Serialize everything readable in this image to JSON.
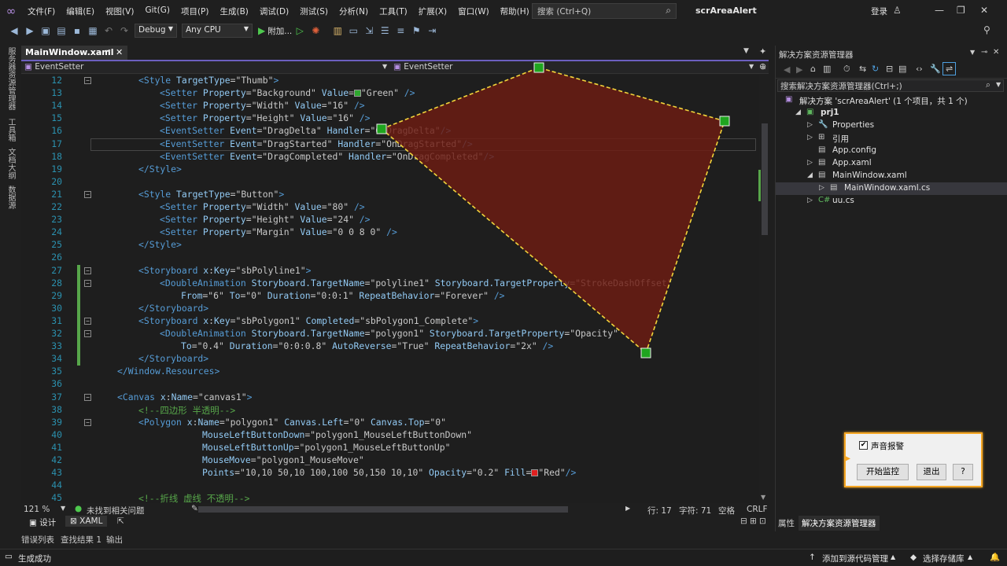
{
  "menu": {
    "items": [
      "文件(F)",
      "编辑(E)",
      "视图(V)",
      "Git(G)",
      "项目(P)",
      "生成(B)",
      "调试(D)",
      "测试(S)",
      "分析(N)",
      "工具(T)",
      "扩展(X)",
      "窗口(W)",
      "帮助(H)"
    ],
    "search_placeholder": "搜索 (Ctrl+Q)",
    "solution_name": "scrAreaAlert",
    "login": "登录"
  },
  "toolbar": {
    "config": "Debug",
    "platform": "Any CPU",
    "attach": "附加..."
  },
  "left_strip": [
    "服务器资源管理器",
    "工具箱",
    "文档大纲",
    "数据源"
  ],
  "tab": {
    "label": "MainWindow.xaml"
  },
  "nav": {
    "left": "EventSetter",
    "right": "EventSetter"
  },
  "code": [
    {
      "n": "12",
      "s": [
        [
          "t",
          "<Style "
        ],
        [
          "an",
          "TargetType"
        ],
        [
          "q",
          "=\""
        ],
        [
          "av",
          "Thumb"
        ],
        [
          "q",
          "\""
        ],
        [
          "t",
          ">"
        ]
      ]
    },
    {
      "n": "13",
      "s": [
        [
          "t",
          "<Setter "
        ],
        [
          "an",
          "Property"
        ],
        [
          "q",
          "=\""
        ],
        [
          "av",
          "Background"
        ],
        [
          "q",
          "\" "
        ],
        [
          "an",
          "Value"
        ],
        [
          "q",
          "="
        ],
        [
          "sw",
          "#2fa82f"
        ],
        [
          "q",
          "\""
        ],
        [
          "av",
          "Green"
        ],
        [
          "q",
          "\" "
        ],
        [
          "t",
          "/>"
        ]
      ]
    },
    {
      "n": "14",
      "s": [
        [
          "t",
          "<Setter "
        ],
        [
          "an",
          "Property"
        ],
        [
          "q",
          "=\""
        ],
        [
          "av",
          "Width"
        ],
        [
          "q",
          "\" "
        ],
        [
          "an",
          "Value"
        ],
        [
          "q",
          "=\""
        ],
        [
          "av",
          "16"
        ],
        [
          "q",
          "\" "
        ],
        [
          "t",
          "/>"
        ]
      ]
    },
    {
      "n": "15",
      "s": [
        [
          "t",
          "<Setter "
        ],
        [
          "an",
          "Property"
        ],
        [
          "q",
          "=\""
        ],
        [
          "av",
          "Height"
        ],
        [
          "q",
          "\" "
        ],
        [
          "an",
          "Value"
        ],
        [
          "q",
          "=\""
        ],
        [
          "av",
          "16"
        ],
        [
          "q",
          "\" "
        ],
        [
          "t",
          "/>"
        ]
      ]
    },
    {
      "n": "16",
      "s": [
        [
          "t",
          "<EventSetter "
        ],
        [
          "an",
          "Event"
        ],
        [
          "q",
          "=\""
        ],
        [
          "av",
          "DragDelta"
        ],
        [
          "q",
          "\" "
        ],
        [
          "an",
          "Handler"
        ],
        [
          "q",
          "=\""
        ],
        [
          "av",
          "OnDragDelta"
        ],
        [
          "q",
          "\""
        ],
        [
          "t",
          "/>"
        ]
      ]
    },
    {
      "n": "17",
      "s": [
        [
          "t",
          "<EventSetter "
        ],
        [
          "an",
          "Event"
        ],
        [
          "q",
          "=\""
        ],
        [
          "av",
          "DragStarted"
        ],
        [
          "q",
          "\" "
        ],
        [
          "an",
          "Handler"
        ],
        [
          "q",
          "=\""
        ],
        [
          "av",
          "OnDragStarted"
        ],
        [
          "q",
          "\""
        ],
        [
          "t",
          "/>"
        ]
      ]
    },
    {
      "n": "18",
      "s": [
        [
          "t",
          "<EventSetter "
        ],
        [
          "an",
          "Event"
        ],
        [
          "q",
          "=\""
        ],
        [
          "av",
          "DragCompleted"
        ],
        [
          "q",
          "\" "
        ],
        [
          "an",
          "Handler"
        ],
        [
          "q",
          "=\""
        ],
        [
          "av",
          "OnDragCompleted"
        ],
        [
          "q",
          "\""
        ],
        [
          "t",
          "/>"
        ]
      ]
    },
    {
      "n": "19",
      "s": [
        [
          "t",
          "</Style>"
        ]
      ]
    },
    {
      "n": "20",
      "s": []
    },
    {
      "n": "21",
      "s": [
        [
          "t",
          "<Style "
        ],
        [
          "an",
          "TargetType"
        ],
        [
          "q",
          "=\""
        ],
        [
          "av",
          "Button"
        ],
        [
          "q",
          "\""
        ],
        [
          "t",
          ">"
        ]
      ]
    },
    {
      "n": "22",
      "s": [
        [
          "t",
          "<Setter "
        ],
        [
          "an",
          "Property"
        ],
        [
          "q",
          "=\""
        ],
        [
          "av",
          "Width"
        ],
        [
          "q",
          "\" "
        ],
        [
          "an",
          "Value"
        ],
        [
          "q",
          "=\""
        ],
        [
          "av",
          "80"
        ],
        [
          "q",
          "\" "
        ],
        [
          "t",
          "/>"
        ]
      ]
    },
    {
      "n": "23",
      "s": [
        [
          "t",
          "<Setter "
        ],
        [
          "an",
          "Property"
        ],
        [
          "q",
          "=\""
        ],
        [
          "av",
          "Height"
        ],
        [
          "q",
          "\" "
        ],
        [
          "an",
          "Value"
        ],
        [
          "q",
          "=\""
        ],
        [
          "av",
          "24"
        ],
        [
          "q",
          "\" "
        ],
        [
          "t",
          "/>"
        ]
      ]
    },
    {
      "n": "24",
      "s": [
        [
          "t",
          "<Setter "
        ],
        [
          "an",
          "Property"
        ],
        [
          "q",
          "=\""
        ],
        [
          "av",
          "Margin"
        ],
        [
          "q",
          "\" "
        ],
        [
          "an",
          "Value"
        ],
        [
          "q",
          "=\""
        ],
        [
          "av",
          "0 0 8 0"
        ],
        [
          "q",
          "\" "
        ],
        [
          "t",
          "/>"
        ]
      ]
    },
    {
      "n": "25",
      "s": [
        [
          "t",
          "</Style>"
        ]
      ]
    },
    {
      "n": "26",
      "s": []
    },
    {
      "n": "27",
      "s": [
        [
          "t",
          "<Storyboard "
        ],
        [
          "an",
          "x"
        ],
        [
          "q",
          ":"
        ],
        [
          "an",
          "Key"
        ],
        [
          "q",
          "=\""
        ],
        [
          "av",
          "sbPolyline1"
        ],
        [
          "q",
          "\""
        ],
        [
          "t",
          ">"
        ]
      ]
    },
    {
      "n": "28",
      "s": [
        [
          "t",
          "<DoubleAnimation "
        ],
        [
          "an",
          "Storyboard.TargetName"
        ],
        [
          "q",
          "=\""
        ],
        [
          "av",
          "polyline1"
        ],
        [
          "q",
          "\" "
        ],
        [
          "an",
          "Storyboard.TargetProperty"
        ],
        [
          "q",
          "=\""
        ],
        [
          "av",
          "StrokeDashOffset"
        ],
        [
          "q",
          "\""
        ]
      ]
    },
    {
      "n": "29",
      "s": [
        [
          "an",
          "From"
        ],
        [
          "q",
          "=\""
        ],
        [
          "av",
          "6"
        ],
        [
          "q",
          "\" "
        ],
        [
          "an",
          "To"
        ],
        [
          "q",
          "=\""
        ],
        [
          "av",
          "0"
        ],
        [
          "q",
          "\" "
        ],
        [
          "an",
          "Duration"
        ],
        [
          "q",
          "=\""
        ],
        [
          "av",
          "0:0:1"
        ],
        [
          "q",
          "\" "
        ],
        [
          "an",
          "RepeatBehavior"
        ],
        [
          "q",
          "=\""
        ],
        [
          "av",
          "Forever"
        ],
        [
          "q",
          "\" "
        ],
        [
          "t",
          "/>"
        ]
      ]
    },
    {
      "n": "30",
      "s": [
        [
          "t",
          "</Storyboard>"
        ]
      ]
    },
    {
      "n": "31",
      "s": [
        [
          "t",
          "<Storyboard "
        ],
        [
          "an",
          "x"
        ],
        [
          "q",
          ":"
        ],
        [
          "an",
          "Key"
        ],
        [
          "q",
          "=\""
        ],
        [
          "av",
          "sbPolygon1"
        ],
        [
          "q",
          "\" "
        ],
        [
          "an",
          "Completed"
        ],
        [
          "q",
          "=\""
        ],
        [
          "av",
          "sbPolygon1_Complete"
        ],
        [
          "q",
          "\""
        ],
        [
          "t",
          ">"
        ]
      ]
    },
    {
      "n": "32",
      "s": [
        [
          "t",
          "<DoubleAnimation "
        ],
        [
          "an",
          "Storyboard.TargetName"
        ],
        [
          "q",
          "=\""
        ],
        [
          "av",
          "polygon1"
        ],
        [
          "q",
          "\" "
        ],
        [
          "an",
          "Storyboard.TargetProperty"
        ],
        [
          "q",
          "=\""
        ],
        [
          "av",
          "Opacity"
        ],
        [
          "q",
          "\""
        ]
      ]
    },
    {
      "n": "33",
      "s": [
        [
          "an",
          "To"
        ],
        [
          "q",
          "=\""
        ],
        [
          "av",
          "0.4"
        ],
        [
          "q",
          "\" "
        ],
        [
          "an",
          "Duration"
        ],
        [
          "q",
          "=\""
        ],
        [
          "av",
          "0:0:0.8"
        ],
        [
          "q",
          "\" "
        ],
        [
          "an",
          "AutoReverse"
        ],
        [
          "q",
          "=\""
        ],
        [
          "av",
          "True"
        ],
        [
          "q",
          "\" "
        ],
        [
          "an",
          "RepeatBehavior"
        ],
        [
          "q",
          "=\""
        ],
        [
          "av",
          "2x"
        ],
        [
          "q",
          "\" "
        ],
        [
          "t",
          "/>"
        ]
      ]
    },
    {
      "n": "34",
      "s": [
        [
          "t",
          "</Storyboard>"
        ]
      ]
    },
    {
      "n": "35",
      "s": [
        [
          "t",
          "</Window.Resources>"
        ]
      ]
    },
    {
      "n": "36",
      "s": []
    },
    {
      "n": "37",
      "s": [
        [
          "t",
          "<Canvas "
        ],
        [
          "an",
          "x"
        ],
        [
          "q",
          ":"
        ],
        [
          "an",
          "Name"
        ],
        [
          "q",
          "=\""
        ],
        [
          "av",
          "canvas1"
        ],
        [
          "q",
          "\""
        ],
        [
          "t",
          ">"
        ]
      ]
    },
    {
      "n": "38",
      "s": [
        [
          "cm",
          "<!--四边形 半透明-->"
        ]
      ]
    },
    {
      "n": "39",
      "s": [
        [
          "t",
          "<Polygon "
        ],
        [
          "an",
          "x"
        ],
        [
          "q",
          ":"
        ],
        [
          "an",
          "Name"
        ],
        [
          "q",
          "=\""
        ],
        [
          "av",
          "polygon1"
        ],
        [
          "q",
          "\" "
        ],
        [
          "an",
          "Canvas.Left"
        ],
        [
          "q",
          "=\""
        ],
        [
          "av",
          "0"
        ],
        [
          "q",
          "\" "
        ],
        [
          "an",
          "Canvas.Top"
        ],
        [
          "q",
          "=\""
        ],
        [
          "av",
          "0"
        ],
        [
          "q",
          "\""
        ]
      ]
    },
    {
      "n": "40",
      "s": [
        [
          "an",
          "MouseLeftButtonDown"
        ],
        [
          "q",
          "=\""
        ],
        [
          "av",
          "polygon1_MouseLeftButtonDown"
        ],
        [
          "q",
          "\""
        ]
      ]
    },
    {
      "n": "41",
      "s": [
        [
          "an",
          "MouseLeftButtonUp"
        ],
        [
          "q",
          "=\""
        ],
        [
          "av",
          "polygon1_MouseLeftButtonUp"
        ],
        [
          "q",
          "\""
        ]
      ]
    },
    {
      "n": "42",
      "s": [
        [
          "an",
          "MouseMove"
        ],
        [
          "q",
          "=\""
        ],
        [
          "av",
          "polygon1_MouseMove"
        ],
        [
          "q",
          "\""
        ]
      ]
    },
    {
      "n": "43",
      "s": [
        [
          "an",
          "Points"
        ],
        [
          "q",
          "=\""
        ],
        [
          "av",
          "10,10 50,10 100,100 50,150 10,10"
        ],
        [
          "q",
          "\" "
        ],
        [
          "an",
          "Opacity"
        ],
        [
          "q",
          "=\""
        ],
        [
          "av",
          "0.2"
        ],
        [
          "q",
          "\" "
        ],
        [
          "an",
          "Fill"
        ],
        [
          "q",
          "="
        ],
        [
          "sw",
          "#e02020"
        ],
        [
          "q",
          "\""
        ],
        [
          "av",
          "Red"
        ],
        [
          "q",
          "\""
        ],
        [
          "t",
          "/>"
        ]
      ]
    },
    {
      "n": "44",
      "s": []
    },
    {
      "n": "45",
      "s": [
        [
          "cm",
          "<!--折线 虚线 不透明-->"
        ]
      ]
    }
  ],
  "editor_status": {
    "zoom": "121 %",
    "issues": "未找到相关问题",
    "row": "行: 17",
    "col": "字符: 71",
    "ws": "空格",
    "eol": "CRLF"
  },
  "split": {
    "design": "设计",
    "xaml": "XAML"
  },
  "bottom_tabs": [
    "错误列表",
    "查找结果 1",
    "输出"
  ],
  "status": {
    "left": "生成成功",
    "source_control": "添加到源代码管理",
    "repo": "选择存储库"
  },
  "solution_explorer": {
    "title": "解决方案资源管理器",
    "search": "搜索解决方案资源管理器(Ctrl+;)",
    "tree": [
      {
        "label": "解决方案 'scrAreaAlert' (1 个项目，共 1 个)",
        "indent": 0,
        "tw": "",
        "icon": "▣",
        "iconColor": "#b48ee0"
      },
      {
        "label": "prj1",
        "indent": 1,
        "tw": "◢",
        "icon": "▣",
        "iconColor": "#5fb75f",
        "bold": true
      },
      {
        "label": "Properties",
        "indent": 2,
        "tw": "▷",
        "icon": "🔧",
        "iconColor": "#c8c8c8"
      },
      {
        "label": "引用",
        "indent": 2,
        "tw": "▷",
        "icon": "⊞",
        "iconColor": "#c8c8c8"
      },
      {
        "label": "App.config",
        "indent": 2,
        "tw": "",
        "icon": "▤",
        "iconColor": "#c8c8c8"
      },
      {
        "label": "App.xaml",
        "indent": 2,
        "tw": "▷",
        "icon": "▤",
        "iconColor": "#c8c8c8"
      },
      {
        "label": "MainWindow.xaml",
        "indent": 2,
        "tw": "◢",
        "icon": "▤",
        "iconColor": "#c8c8c8"
      },
      {
        "label": "MainWindow.xaml.cs",
        "indent": 3,
        "tw": "▷",
        "icon": "▤",
        "iconColor": "#c8c8c8",
        "sel": true
      },
      {
        "label": "uu.cs",
        "indent": 2,
        "tw": "▷",
        "icon": "C#",
        "iconColor": "#5fb75f"
      }
    ],
    "bottom_tabs": [
      "属性",
      "解决方案资源管理器"
    ]
  },
  "popup": {
    "checkbox_label": "声音报警",
    "start_button": "开始监控",
    "exit_button": "退出",
    "help_button": "?"
  }
}
